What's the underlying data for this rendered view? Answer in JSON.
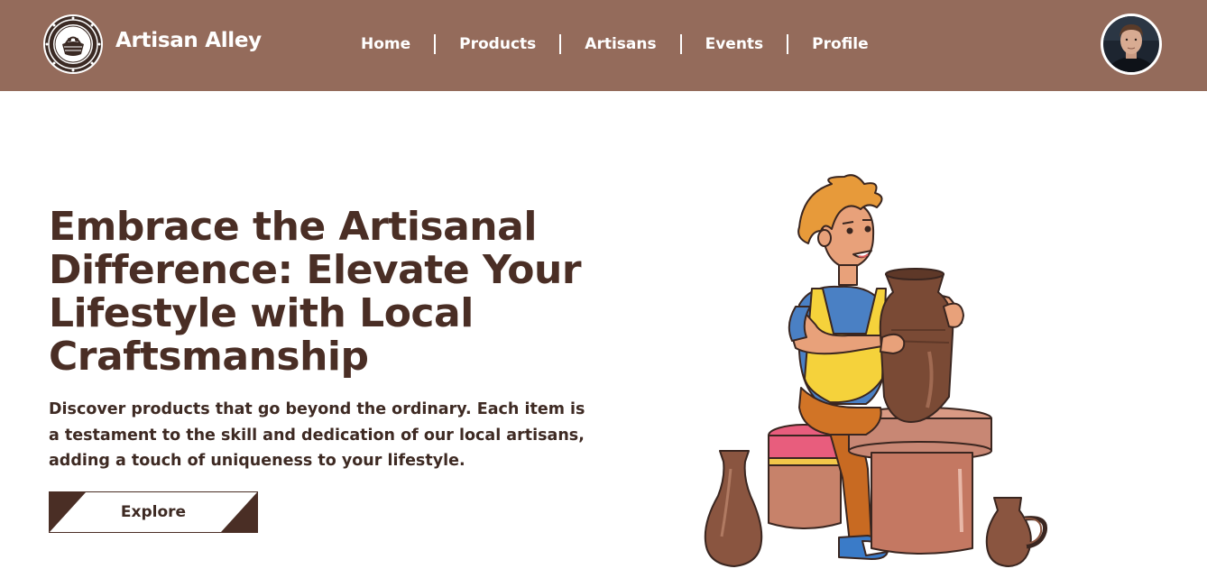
{
  "header": {
    "brand": "Artisan Alley",
    "nav": [
      {
        "label": "Home"
      },
      {
        "label": "Products"
      },
      {
        "label": "Artisans"
      },
      {
        "label": "Events"
      },
      {
        "label": "Profile"
      }
    ]
  },
  "hero": {
    "title": "Embrace the Artisanal Difference: Elevate Your Lifestyle with Local Craftsmanship",
    "subtitle": "Discover products that go beyond the ordinary. Each item is a testament to the skill and dedication of our local artisans, adding a touch of uniqueness to your lifestyle.",
    "cta": "Explore"
  },
  "icons": {
    "logo": "artisan-alley-logo-icon",
    "avatar": "user-avatar",
    "illustration": "potter-illustration"
  },
  "colors": {
    "header_bg": "#946b5b",
    "text_dark": "#4a2e25",
    "accent": "#4a2e25"
  }
}
